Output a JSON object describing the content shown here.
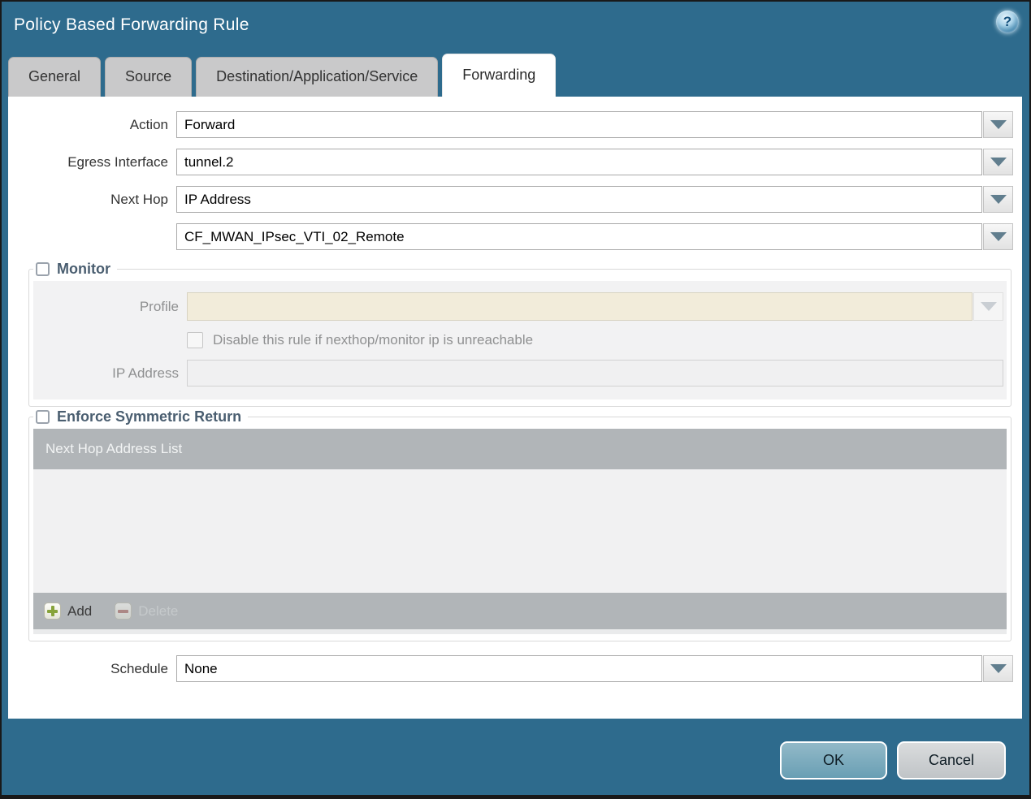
{
  "dialog": {
    "title": "Policy Based Forwarding Rule",
    "help_glyph": "?"
  },
  "tabs": [
    {
      "label": "General",
      "active": false
    },
    {
      "label": "Source",
      "active": false
    },
    {
      "label": "Destination/Application/Service",
      "active": false
    },
    {
      "label": "Forwarding",
      "active": true
    }
  ],
  "form": {
    "action_label": "Action",
    "action_value": "Forward",
    "egress_label": "Egress Interface",
    "egress_value": "tunnel.2",
    "next_hop_label": "Next Hop",
    "next_hop_value": "IP Address",
    "next_hop_address_value": "CF_MWAN_IPsec_VTI_02_Remote",
    "schedule_label": "Schedule",
    "schedule_value": "None"
  },
  "monitor": {
    "title": "Monitor",
    "checked": false,
    "profile_label": "Profile",
    "profile_value": "",
    "disable_rule_label": "Disable this rule if nexthop/monitor ip is unreachable",
    "disable_rule_checked": false,
    "ip_address_label": "IP Address",
    "ip_address_value": ""
  },
  "symmetric_return": {
    "title": "Enforce Symmetric Return",
    "checked": false,
    "list_header": "Next Hop Address List",
    "rows": [],
    "add_label": "Add",
    "delete_label": "Delete",
    "delete_enabled": false
  },
  "footer": {
    "ok_label": "OK",
    "cancel_label": "Cancel"
  },
  "colors": {
    "titlebar_teal": "#2e6b8d",
    "section_title": "#4a5e70",
    "table_bar_gray": "#b1b5b8",
    "disabled_field_beige": "#f2ecda",
    "ok_button_teal": "#74a7bb",
    "cancel_button_gray": "#c7cacc",
    "add_plus_green": "#87a33a",
    "delete_minus_red": "#a8645c"
  }
}
